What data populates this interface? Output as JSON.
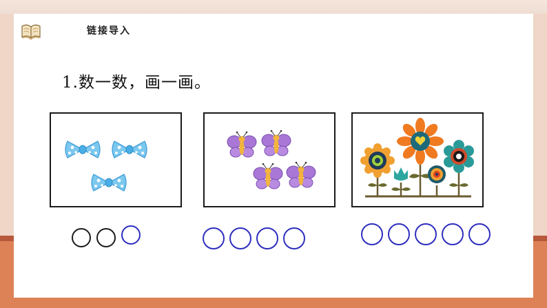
{
  "header": {
    "title": "链接导入",
    "icon": "book-icon"
  },
  "question": {
    "text": "1.数一数，画一画。"
  },
  "groups": [
    {
      "name": "bows",
      "picture_icon": "bow-icon",
      "item_count": 3,
      "circles": [
        "black",
        "black",
        "blue"
      ]
    },
    {
      "name": "butterflies",
      "picture_icon": "butterfly-icon",
      "item_count": 4,
      "circles": [
        "blue",
        "blue",
        "blue",
        "blue"
      ]
    },
    {
      "name": "flowers",
      "picture_icon": "flower-icon",
      "item_count": 5,
      "circles": [
        "blue",
        "blue",
        "blue",
        "blue",
        "blue"
      ]
    }
  ],
  "colors": {
    "blue_circle": "#2d2dbf",
    "black_circle": "#1a1a1a",
    "floor": "#dc8256",
    "rail": "#b7583b"
  }
}
